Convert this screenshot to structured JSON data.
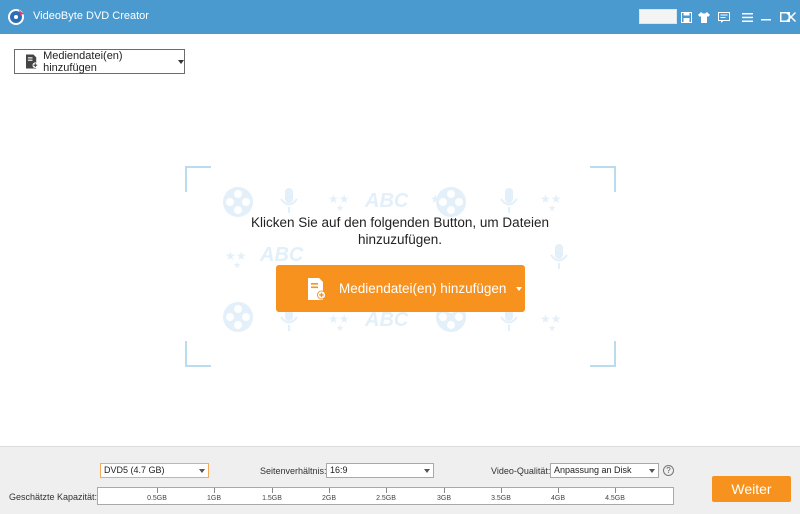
{
  "app": {
    "title": "VideoByte DVD Creator"
  },
  "titlebar": {
    "icons": [
      "save-icon",
      "shirt-icon",
      "feedback-icon",
      "menu-icon",
      "minimize-icon",
      "maximize-icon",
      "close-icon"
    ]
  },
  "toolbar": {
    "add_media_label": "Mediendatei(en) hinzufügen"
  },
  "dropzone": {
    "message": "Klicken Sie auf den folgenden Button, um Dateien hinzuzufügen.",
    "add_button_label": "Mediendatei(en) hinzufügen",
    "watermark_text": "ABC"
  },
  "bottom": {
    "disc_type": "DVD5 (4.7 GB)",
    "aspect_label": "Seitenverhältnis:",
    "aspect_value": "16:9",
    "quality_label": "Video-Qualität:",
    "quality_value": "Anpassung an Disk",
    "help_symbol": "?",
    "capacity_label": "Geschätzte Kapazität:",
    "capacity_ticks": [
      "0.5GB",
      "1GB",
      "1.5GB",
      "2GB",
      "2.5GB",
      "3GB",
      "3.5GB",
      "4GB",
      "4.5GB"
    ],
    "next_label": "Weiter"
  },
  "colors": {
    "titlebar": "#4a9ad0",
    "accent": "#f7921e",
    "watermark": "#e3f0f9"
  }
}
